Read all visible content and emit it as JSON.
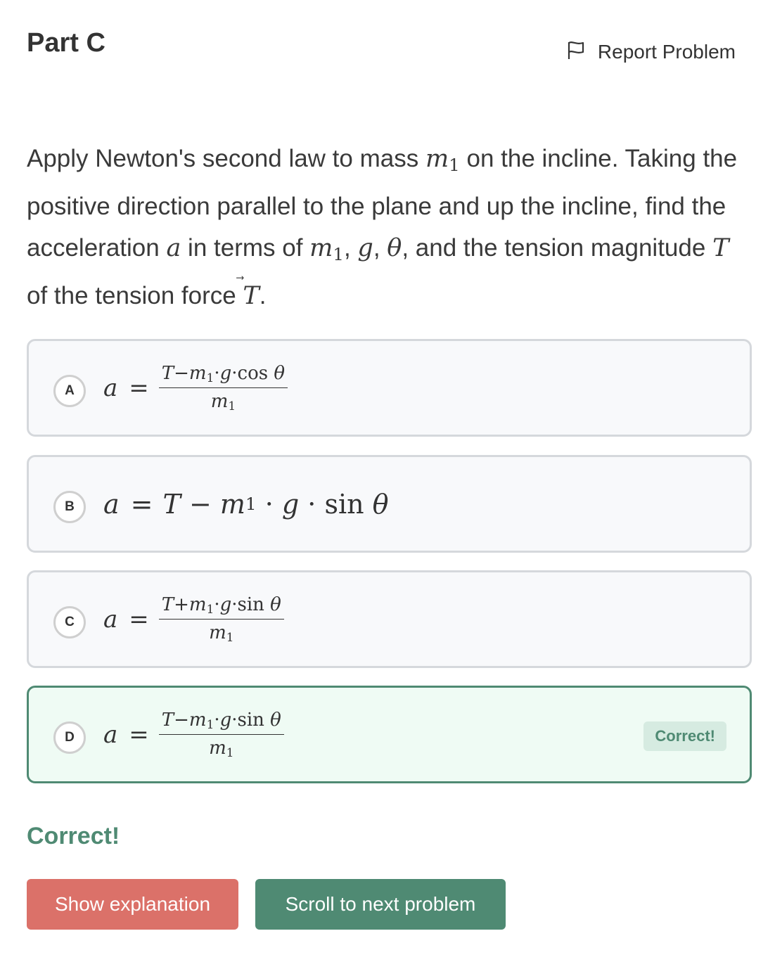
{
  "header": {
    "title": "Part C",
    "report_label": "Report Problem"
  },
  "question": {
    "t1": "Apply Newton's second law to mass ",
    "m": "m",
    "sub1": "1",
    "t2": " on the incline. Taking the positive direction parallel to the plane and up the incline, find the acceleration ",
    "a": "a",
    "t3": " in terms of ",
    "m_b": "m",
    "sub1_b": "1",
    "c1": ", ",
    "g": "g",
    "c2": ", ",
    "theta": "θ",
    "t4": ", and the tension magnitude ",
    "T": "T",
    "t5": " of the tension force ",
    "Tvec": "T",
    "arrow": "⃗",
    "end": "."
  },
  "options": [
    {
      "letter": "A",
      "lhs": "a",
      "eq": "=",
      "num_T": "T",
      "num_op": "−",
      "num_m": "m",
      "num_sub": "1",
      "num_rest1": "·",
      "num_g": "g",
      "num_rest2": "·",
      "num_fn": "cos",
      "num_theta": " θ",
      "den_m": "m",
      "den_sub": "1"
    },
    {
      "letter": "B",
      "lhs": "a",
      "eq": "=",
      "rhs_T": "T",
      "rhs_minus": " − ",
      "rhs_m": "m",
      "rhs_sub": "1",
      "rhs_dot1": " · ",
      "rhs_g": "g",
      "rhs_dot2": " · ",
      "rhs_fn": "sin",
      "rhs_theta": " θ"
    },
    {
      "letter": "C",
      "lhs": "a",
      "eq": "=",
      "num_T": "T",
      "num_op": "+",
      "num_m": "m",
      "num_sub": "1",
      "num_rest1": "·",
      "num_g": "g",
      "num_rest2": "·",
      "num_fn": "sin",
      "num_theta": " θ",
      "den_m": "m",
      "den_sub": "1"
    },
    {
      "letter": "D",
      "lhs": "a",
      "eq": "=",
      "num_T": "T",
      "num_op": "−",
      "num_m": "m",
      "num_sub": "1",
      "num_rest1": "·",
      "num_g": "g",
      "num_rest2": "·",
      "num_fn": "sin",
      "num_theta": " θ",
      "den_m": "m",
      "den_sub": "1",
      "badge": "Correct!"
    }
  ],
  "result": "Correct!",
  "buttons": {
    "explain": "Show explanation",
    "next": "Scroll to next problem"
  },
  "colors": {
    "correct": "#4f8a73",
    "explain_button": "#db7169"
  }
}
